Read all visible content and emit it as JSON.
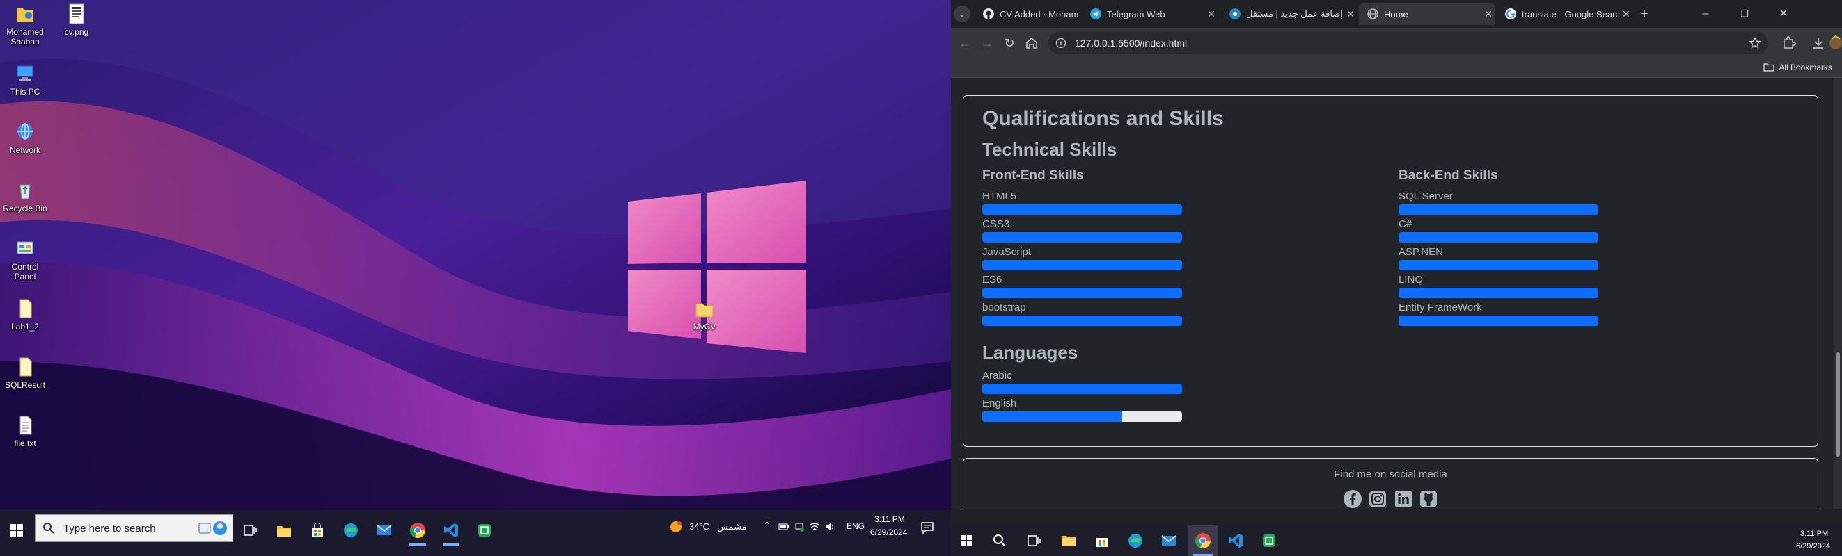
{
  "desktop_left": {
    "icons": [
      {
        "label": "Mohamed Shaban",
        "icon": "user-folder-icon"
      },
      {
        "label": "cv.png",
        "icon": "image-file-icon"
      },
      {
        "label": "This PC",
        "icon": "computer-icon"
      },
      {
        "label": "Network",
        "icon": "network-icon"
      },
      {
        "label": "Recycle Bin",
        "icon": "recycle-bin-icon"
      },
      {
        "label": "Control Panel",
        "icon": "control-panel-icon"
      },
      {
        "label": "Lab1_2",
        "icon": "file-icon"
      },
      {
        "label": "SQLResult",
        "icon": "file-icon"
      },
      {
        "label": "file.txt",
        "icon": "text-file-icon"
      },
      {
        "label": "MyCV",
        "icon": "folder-icon"
      }
    ],
    "taskbar": {
      "search_placeholder": "Type here to search",
      "weather_temp": "34°C",
      "weather_desc": "مشمس",
      "language": "ENG",
      "time": "3:11 PM",
      "date": "6/29/2024"
    }
  },
  "browser": {
    "tabs": [
      {
        "label": "CV Added · MohamedSh",
        "icon": "github-icon"
      },
      {
        "label": "Telegram Web",
        "icon": "telegram-icon"
      },
      {
        "label": "إضافة عمل جديد | مستقل",
        "icon": "mostaql-icon"
      },
      {
        "label": "Home",
        "icon": "globe-icon",
        "active": true
      },
      {
        "label": "translate - Google Search",
        "icon": "google-icon"
      }
    ],
    "url": "127.0.0.1:5500/index.html",
    "all_bookmarks": "All Bookmarks"
  },
  "page": {
    "title": "Qualifications and Skills",
    "technical_title": "Technical Skills",
    "frontend_title": "Front-End Skills",
    "backend_title": "Back-End Skills",
    "frontend_skills": [
      {
        "name": "HTML5",
        "level": 1.0
      },
      {
        "name": "CSS3",
        "level": 1.0
      },
      {
        "name": "JavaScript",
        "level": 1.0
      },
      {
        "name": "ES6",
        "level": 1.0
      },
      {
        "name": "bootstrap",
        "level": 1.0
      }
    ],
    "backend_skills": [
      {
        "name": "SQL Server",
        "level": 1.0
      },
      {
        "name": "C#",
        "level": 1.0
      },
      {
        "name": "ASP.NEN",
        "level": 1.0
      },
      {
        "name": "LINQ",
        "level": 1.0
      },
      {
        "name": "Entity FrameWork",
        "level": 1.0
      }
    ],
    "languages_title": "Languages",
    "languages": [
      {
        "name": "Arabic",
        "level": 1.0
      },
      {
        "name": "English",
        "level": 0.7
      }
    ],
    "footer_text": "Find me on social media",
    "social_icons": [
      "facebook-icon",
      "instagram-icon",
      "linkedin-icon",
      "github-icon"
    ]
  },
  "taskbar_right": {
    "time": "3:11 PM",
    "date": "6/29/2024"
  },
  "colors": {
    "progress_fill": "#0d6efd",
    "page_bg": "#212529",
    "heading_text": "#adb5bd"
  }
}
